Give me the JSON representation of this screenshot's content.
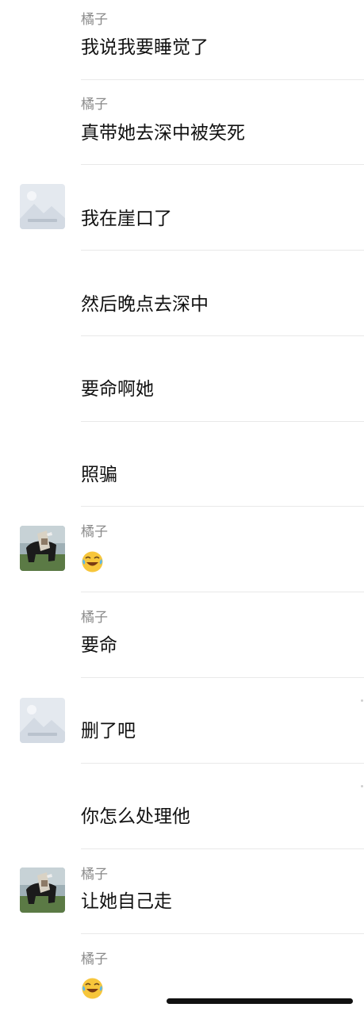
{
  "chat": {
    "messages": [
      {
        "sender": "橘子",
        "text": "我说我要睡觉了",
        "avatar": "none"
      },
      {
        "sender": "橘子",
        "text": "真带她去深中被笑死",
        "avatar": "none"
      },
      {
        "sender": "",
        "text": "我在崖口了",
        "avatar": "image-placeholder-avatar"
      },
      {
        "sender": "",
        "text": "然后晚点去深中",
        "avatar": "none"
      },
      {
        "sender": "",
        "text": "要命啊她",
        "avatar": "none"
      },
      {
        "sender": "",
        "text": "照骗",
        "avatar": "none"
      },
      {
        "sender": "橘子",
        "text": "",
        "emoji": "crying-laughing-emoji",
        "avatar": "cow-photo-avatar"
      },
      {
        "sender": "橘子",
        "text": "要命",
        "avatar": "none"
      },
      {
        "sender": "",
        "text": "删了吧",
        "avatar": "image-placeholder-avatar"
      },
      {
        "sender": "",
        "text": "你怎么处理他",
        "avatar": "none"
      },
      {
        "sender": "橘子",
        "text": "让她自己走",
        "avatar": "cow-photo-avatar"
      },
      {
        "sender": "橘子",
        "text": "",
        "emoji": "crying-laughing-emoji",
        "avatar": "none"
      }
    ]
  },
  "colors": {
    "background": "#ffffff",
    "sender_name": "#8a8a8a",
    "message_text": "#111111",
    "divider": "#e9e9e9",
    "home_indicator": "#111111"
  }
}
